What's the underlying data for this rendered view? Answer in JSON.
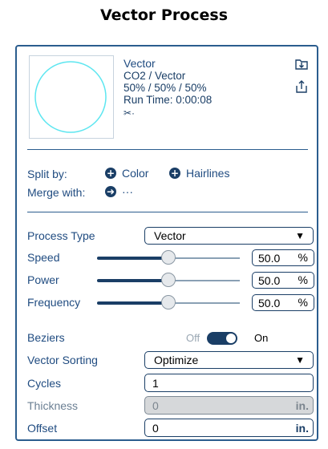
{
  "title": "Vector Process",
  "layer": {
    "name": "Vector",
    "laser": "CO2 / Vector",
    "settings": "50% / 50% / 50%",
    "run_time": "Run Time: 0:00:08",
    "scissors_glyph": "✂·"
  },
  "split": {
    "label": "Split by:",
    "color_label": "Color",
    "hairlines_label": "Hairlines"
  },
  "merge": {
    "label": "Merge with:",
    "more": "···"
  },
  "process_type": {
    "label": "Process Type",
    "value": "Vector"
  },
  "speed": {
    "label": "Speed",
    "value": "50.0",
    "unit": "%",
    "level": 0.5
  },
  "power": {
    "label": "Power",
    "value": "50.0",
    "unit": "%",
    "level": 0.5
  },
  "frequency": {
    "label": "Frequency",
    "value": "50.0",
    "unit": "%",
    "level": 0.5
  },
  "beziers": {
    "label": "Beziers",
    "off_label": "Off",
    "on_label": "On",
    "state": "on"
  },
  "vector_sorting": {
    "label": "Vector Sorting",
    "value": "Optimize"
  },
  "cycles": {
    "label": "Cycles",
    "value": "1"
  },
  "thickness": {
    "label": "Thickness",
    "value": "0",
    "unit": "in."
  },
  "offset": {
    "label": "Offset",
    "value": "0",
    "unit": "in."
  },
  "colors": {
    "accent": "#1a3e66",
    "preview_stroke": "#5de6f0",
    "border": "#2b5d8e"
  }
}
